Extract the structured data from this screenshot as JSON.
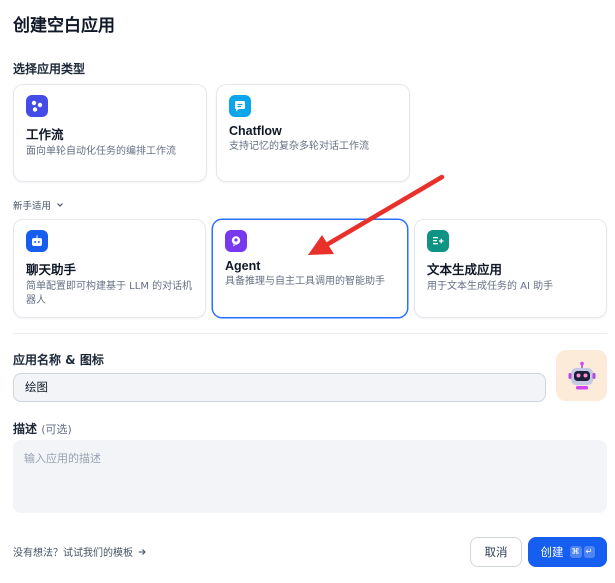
{
  "dialog": {
    "title": "创建空白应用",
    "type_section_label": "选择应用类型",
    "beginner_label": "新手适用"
  },
  "app_types": [
    {
      "name": "工作流",
      "desc": "面向单轮自动化任务的编排工作流",
      "icon": "workflow-icon",
      "color": "#444ce7"
    },
    {
      "name": "Chatflow",
      "desc": "支持记忆的复杂多轮对话工作流",
      "icon": "chatflow-icon",
      "color": "#0ba5ec"
    }
  ],
  "beginner_types": [
    {
      "name": "聊天助手",
      "desc": "简单配置即可构建基于 LLM 的对话机器人",
      "icon": "chat-assistant-icon",
      "color": "#155eef"
    },
    {
      "name": "Agent",
      "desc": "具备推理与自主工具调用的智能助手",
      "icon": "agent-icon",
      "color": "#7839ee",
      "selected": true
    },
    {
      "name": "文本生成应用",
      "desc": "用于文本生成任务的 AI 助手",
      "icon": "text-generation-icon",
      "color": "#0e9384"
    }
  ],
  "name_section": {
    "label": "应用名称 & 图标",
    "value": "绘图",
    "avatar_icon": "robot-avatar-icon"
  },
  "description_section": {
    "label": "描述",
    "optional": "(可选)",
    "placeholder": "输入应用的描述"
  },
  "footer": {
    "template_link": "没有想法？试试我们的模板",
    "cancel_label": "取消",
    "create_label": "创建",
    "shortcut_keys": [
      "⌘",
      "↵"
    ]
  },
  "colors": {
    "primary": "#155eef",
    "selected_border": "#2970ff",
    "annotation_arrow": "#e8312a"
  }
}
